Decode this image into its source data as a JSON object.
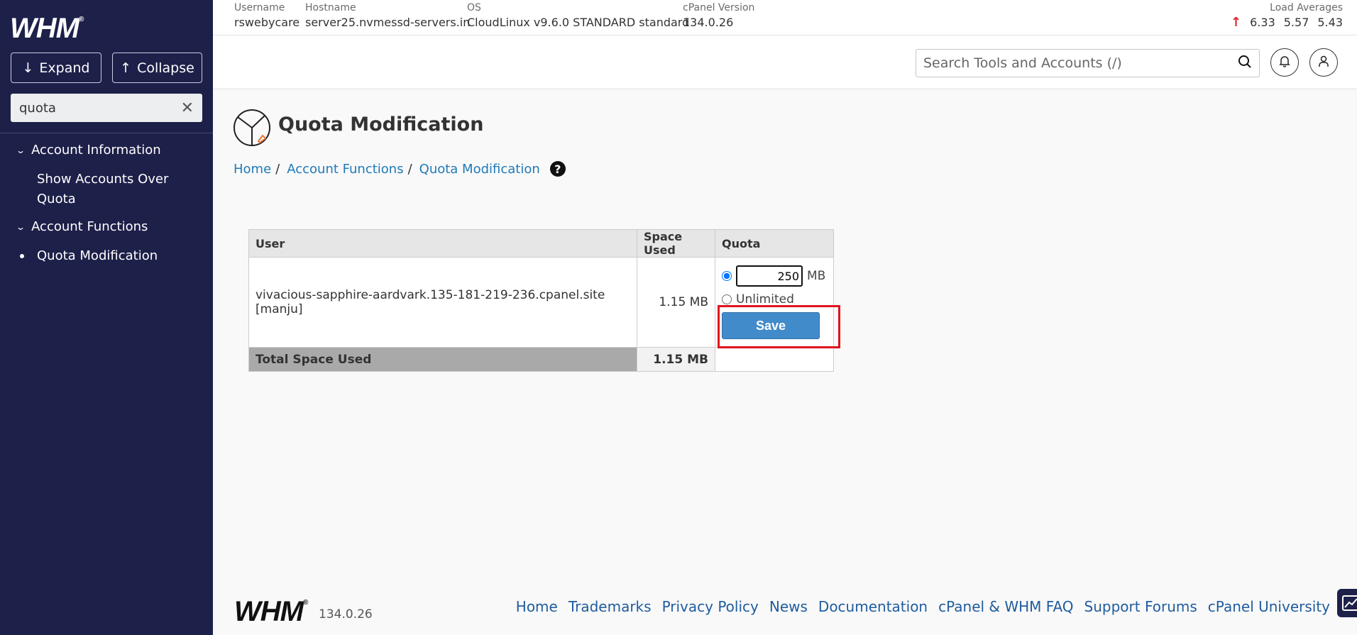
{
  "sidebar": {
    "logo": "WHM",
    "expand_label": "Expand",
    "collapse_label": "Collapse",
    "search_value": "quota",
    "groups": [
      {
        "label": "Account Information",
        "items": [
          "Show Accounts Over Quota"
        ]
      },
      {
        "label": "Account Functions",
        "items": [
          "Quota Modification"
        ]
      }
    ]
  },
  "topinfo": {
    "username_label": "Username",
    "username": "rswebycare",
    "hostname_label": "Hostname",
    "hostname": "server25.nvmessd-servers.in",
    "os_label": "OS",
    "os": "CloudLinux v9.6.0 STANDARD standard",
    "cpanel_label": "cPanel Version",
    "cpanel_version": "134.0.26",
    "load_label": "Load Averages",
    "load": [
      "6.33",
      "5.57",
      "5.43"
    ]
  },
  "header": {
    "search_placeholder": "Search Tools and Accounts (/)"
  },
  "page": {
    "title": "Quota Modification",
    "breadcrumb": [
      "Home",
      "Account Functions",
      "Quota Modification"
    ]
  },
  "table": {
    "headers": [
      "User",
      "Space Used",
      "Quota"
    ],
    "row": {
      "user": "vivacious-sapphire-aardvark.135-181-219-236.cpanel.site [manju]",
      "space_used": "1.15 MB",
      "quota_value": "250",
      "quota_unit": "MB",
      "unlimited_label": "Unlimited",
      "save_label": "Save"
    },
    "total_label": "Total Space Used",
    "total_value": "1.15 MB"
  },
  "footer": {
    "logo": "WHM",
    "version": "134.0.26",
    "links": [
      "Home",
      "Trademarks",
      "Privacy Policy",
      "News",
      "Documentation",
      "cPanel & WHM FAQ",
      "Support Forums",
      "cPanel University"
    ]
  },
  "colors": {
    "sidebar_bg": "#1d2049",
    "link": "#1f7ab8",
    "save_button": "#428bca",
    "highlight": "#e0141e",
    "load_up": "#d9262c"
  }
}
